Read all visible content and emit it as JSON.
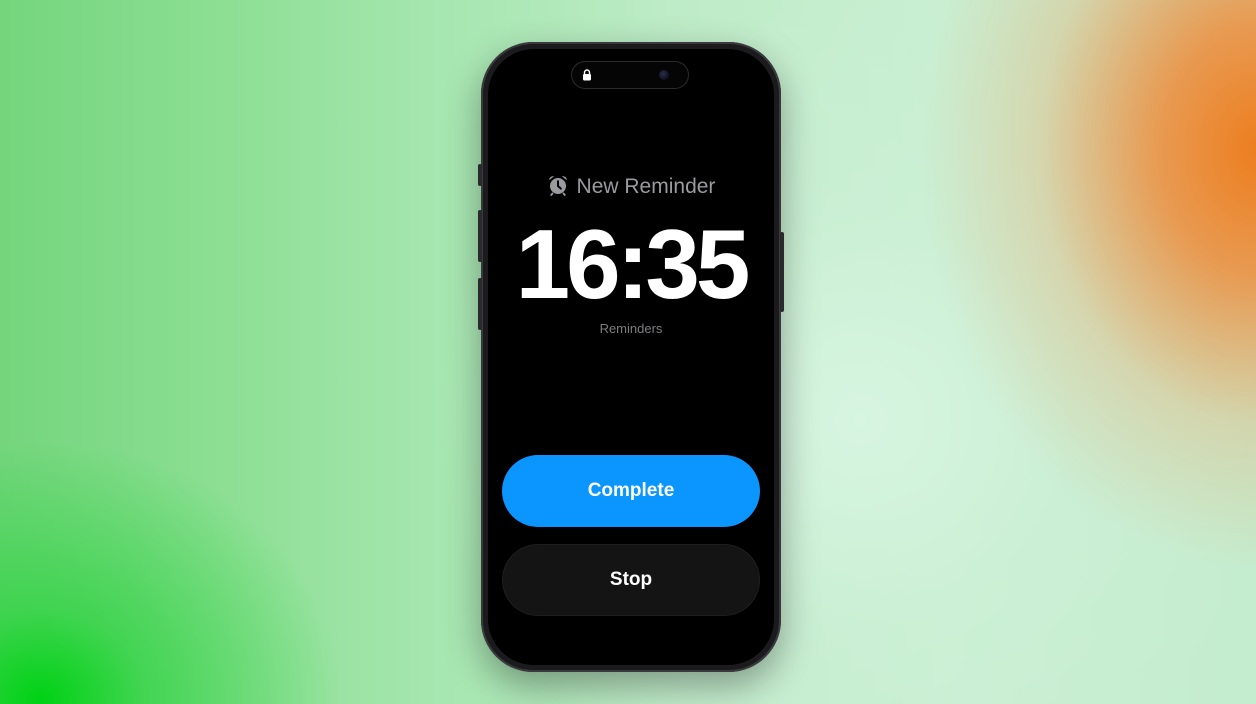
{
  "alarm": {
    "title": "New Reminder",
    "time": "16:35",
    "app_name": "Reminders"
  },
  "actions": {
    "complete_label": "Complete",
    "stop_label": "Stop"
  },
  "icons": {
    "status": "lock-icon",
    "title": "alarm-clock-icon",
    "camera": "camera-icon"
  },
  "colors": {
    "complete_button": "#0a95ff",
    "stop_button": "#141414",
    "screen_background": "#000000",
    "time_text": "#ffffff",
    "title_text": "#9a9a9f"
  }
}
